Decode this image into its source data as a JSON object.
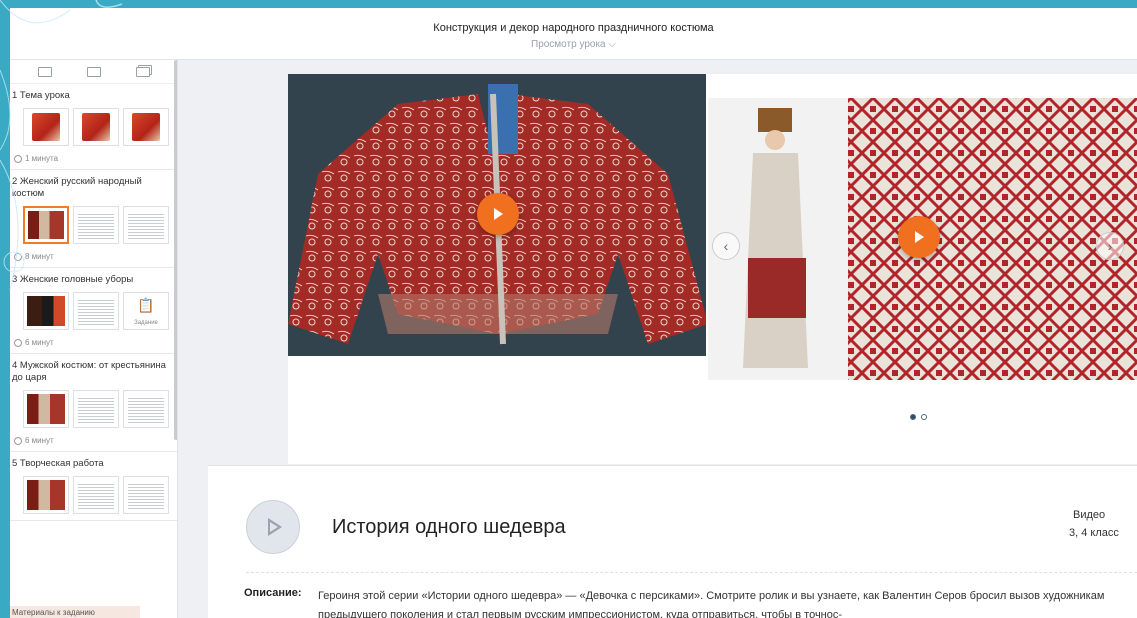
{
  "header": {
    "title": "Конструкция и декор народного праздничного костюма",
    "subtitle": "Просмотр урока"
  },
  "sidebar": {
    "sections": [
      {
        "title": "1  Тема урока",
        "duration": "1 минута"
      },
      {
        "title": "2  Женский русский народный костюм",
        "duration": "8 минут"
      },
      {
        "title": "3  Женские головные уборы",
        "duration": "6 минут",
        "task_label": "Задание"
      },
      {
        "title": "4  Мужской костюм: от крестьянина до царя",
        "duration": "6 минут"
      },
      {
        "title": "5  Творческая работа"
      }
    ],
    "materials_label": "Материалы к заданию"
  },
  "carousel": {
    "active_slide": 1,
    "slide_count": 2
  },
  "video": {
    "title": "История одного шедевра",
    "type": "Видео",
    "grade": "3, 4 класс",
    "description_label": "Описание:",
    "description": "Героиня этой серии «Истории одного шедевра» — «Девочка с персиками». Смотрите ролик и вы узнаете, как Валентин Серов бросил вызов художникам предыдущего поколения и стал первым русским импрессионистом, куда отправиться, чтобы в точнос-"
  },
  "colors": {
    "frame": "#3aa9c4",
    "accent": "#f0701f",
    "selected_border": "#f07b2a"
  }
}
